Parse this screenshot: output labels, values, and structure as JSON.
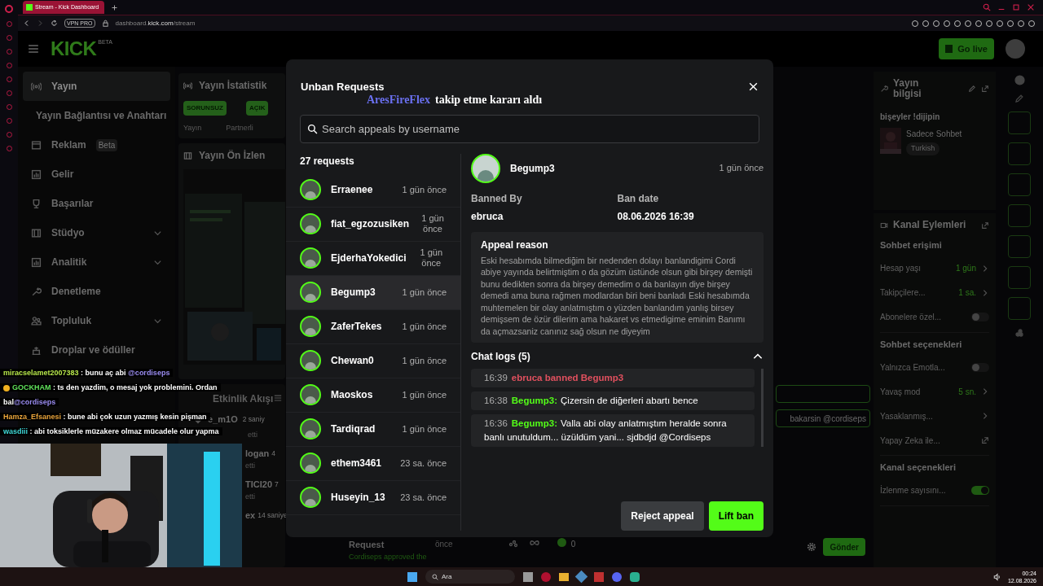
{
  "browser": {
    "tab_title": "Stream - Kick Dashboard",
    "vpn_badge": "VPN PRO",
    "address": {
      "host": "dashboard.",
      "domain": "kick.com",
      "path": "/stream"
    }
  },
  "header": {
    "logo": "KICK",
    "logo_badge": "BETA",
    "go_live": "Go live"
  },
  "nav": [
    {
      "label": "Yayın",
      "selected": true,
      "expandable": false
    },
    {
      "label": "Yayın Bağlantısı ve Anahtarı",
      "selected": false,
      "expandable": false
    },
    {
      "label": "Reklam",
      "selected": false,
      "expandable": false,
      "badge": "Beta"
    },
    {
      "label": "Gelir",
      "selected": false,
      "expandable": false
    },
    {
      "label": "Başarılar",
      "selected": false,
      "expandable": false
    },
    {
      "label": "Stüdyo",
      "selected": false,
      "expandable": true
    },
    {
      "label": "Analitik",
      "selected": false,
      "expandable": true
    },
    {
      "label": "Denetleme",
      "selected": false,
      "expandable": false
    },
    {
      "label": "Topluluk",
      "selected": false,
      "expandable": true
    },
    {
      "label": "Droplar ve ödüller",
      "selected": false,
      "expandable": false
    }
  ],
  "stats_panel": {
    "title": "Yayın İstatistik",
    "badges": [
      "SORUNSUZ",
      "AÇIK"
    ],
    "labels": [
      "Yayın",
      "Partnerli"
    ]
  },
  "preview_panel": {
    "title": "Yayın Ön İzlen"
  },
  "activity_panel": {
    "title": "Etkinlik Akışı",
    "items": [
      {
        "name": "e_m1O",
        "time": "2 saniy",
        "action": "etti"
      },
      {
        "name": "logan",
        "time": "4",
        "action": "etti"
      },
      {
        "name": "TICI20",
        "time": "7",
        "action": "etti"
      },
      {
        "name": "ex",
        "time": "14 saniye"
      }
    ]
  },
  "stream_chat": [
    {
      "user": "miracselamet2007383",
      "color": "#b6e64a",
      "badges": false,
      "parts": [
        {
          "kind": "text",
          "text": " : bunu aç abi "
        },
        {
          "kind": "mention",
          "text": "@cordiseps"
        }
      ]
    },
    {
      "user": "GOCKHAM",
      "color": "#5fe05a",
      "badges": true,
      "parts": [
        {
          "kind": "text",
          "text": " : ts den yazdim, o mesaj yok problemini. Ordan bal"
        },
        {
          "kind": "mention",
          "text": "@cordiseps"
        }
      ]
    },
    {
      "user": "Hamza_Efsanesi",
      "color": "#e8a33a",
      "badges": false,
      "parts": [
        {
          "kind": "text",
          "text": " : bune abi çok uzun yazmış kesin pişman"
        }
      ]
    },
    {
      "user": "wasdiii",
      "color": "#3fd7d7",
      "badges": false,
      "parts": [
        {
          "kind": "text",
          "text": " : abi toksiklerle müzakere olmaz mücadele olur yapma"
        }
      ]
    }
  ],
  "alert": {
    "user": "AresFireFlex",
    "text": "takip etme kararı aldı"
  },
  "modal": {
    "title": "Unban Requests",
    "search": {
      "placeholder": "Search appeals by username"
    },
    "count": "27 requests",
    "requests": [
      {
        "user": "Erraenee",
        "time": "1 gün önce",
        "selected": false
      },
      {
        "user": "fiat_egzozusiken",
        "time": "1 gün önce",
        "selected": false
      },
      {
        "user": "EjderhaYokedici",
        "time": "1 gün önce",
        "selected": false
      },
      {
        "user": "Begump3",
        "time": "1 gün önce",
        "selected": true
      },
      {
        "user": "ZaferTekes",
        "time": "1 gün önce",
        "selected": false
      },
      {
        "user": "Chewan0",
        "time": "1 gün önce",
        "selected": false
      },
      {
        "user": "Maoskos",
        "time": "1 gün önce",
        "selected": false
      },
      {
        "user": "Tardiqrad",
        "time": "1 gün önce",
        "selected": false
      },
      {
        "user": "ethem3461",
        "time": "23 sa. önce",
        "selected": false
      },
      {
        "user": "Huseyin_13",
        "time": "23 sa. önce",
        "selected": false
      }
    ],
    "detail": {
      "user": "Begump3",
      "time": "1 gün önce",
      "banned_by_label": "Banned By",
      "banned_by": "ebruca",
      "ban_date_label": "Ban date",
      "ban_date": "08.06.2026 16:39",
      "appeal_title": "Appeal reason",
      "appeal_text": "Eski hesabımda bilmediğim bir nedenden dolayı banlandigimi Cordi abiye yayında belirtmiştim o da gözüm üstünde olsun gibi birşey demişti bunu dedikten sonra da birşey demedim o da banlayın diye birşey demedi ama buna rağmen modlardan biri beni banladı Eski hesabımda muhtemelen bir olay anlatmıştım o yüzden banlandım yanlış birsey demişsem de özür dilerim ama hakaret vs etmedigime eminim Banımı da açmazsaniz canınız sağ olsun ne diyeyim",
      "chat_logs_title": "Chat logs (5)",
      "chat_logs_expanded": true,
      "logs": [
        {
          "kind": "system",
          "time": "16:39",
          "text": "ebruca banned Begump3"
        },
        {
          "kind": "message",
          "time": "16:38",
          "user": "Begump3:",
          "text": "Çizersin de diğerleri abartı bence"
        },
        {
          "kind": "message",
          "time": "16:36",
          "user": "Begump3:",
          "text": "Valla abi olay anlatmıştım heralde sonra banlı unutuldum... üzüldüm yani... sjdbdjd @Cordiseps"
        }
      ],
      "buttons": [
        {
          "kind": "secondary",
          "label": "Reject appeal"
        },
        {
          "kind": "primary",
          "label": "Lift ban"
        }
      ]
    }
  },
  "chat_column": {
    "message": "bakarsin @cordiseps",
    "send": "Gönder",
    "counter": "0",
    "activity": {
      "title": "Request",
      "text": "Cordiseps approved the",
      "time": "önce"
    }
  },
  "stream_info": {
    "title": "Yayın bilgisi",
    "stream_title": "bişeyler !dijipin",
    "category": "Sadece Sohbet",
    "tag": "Turkish"
  },
  "channel_actions": {
    "title": "Kanal Eylemleri",
    "sections": [
      {
        "title": "Sohbet erişimi",
        "rows": [
          {
            "kind": "value",
            "label": "Hesap yaşı",
            "value": "1 gün"
          },
          {
            "kind": "value",
            "label": "Takipçilere...",
            "value": "1 sa."
          },
          {
            "kind": "toggle",
            "label": "Abonelere özel...",
            "on": false
          }
        ]
      },
      {
        "title": "Sohbet seçenekleri",
        "rows": [
          {
            "kind": "toggle",
            "label": "Yalnızca Emotla...",
            "on": false
          },
          {
            "kind": "value",
            "label": "Yavaş mod",
            "value": "5 sn."
          },
          {
            "kind": "nav",
            "label": "Yasaklanmış..."
          },
          {
            "kind": "link",
            "label": "Yapay Zeka ile..."
          }
        ]
      },
      {
        "title": "Kanal seçenekleri",
        "rows": [
          {
            "kind": "toggle",
            "label": "İzlenme sayısını...",
            "on": true
          }
        ]
      }
    ]
  },
  "taskbar": {
    "search": "Ara",
    "time": "00:24",
    "date": "12.08.2026"
  }
}
